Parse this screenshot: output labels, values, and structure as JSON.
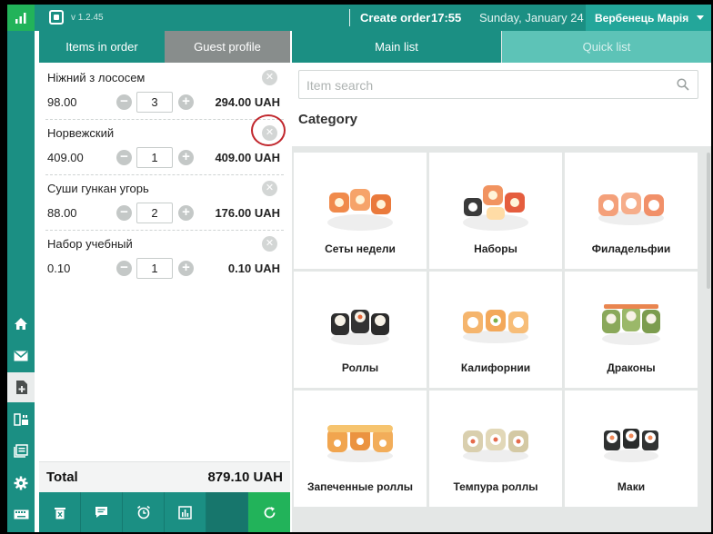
{
  "topbar": {
    "version": "v 1.2.45",
    "create_order": "Create order",
    "time": "17:55",
    "date": "Sunday, January 24",
    "user": "Вербенець Марія"
  },
  "order_tabs": [
    "Items in order",
    "Guest profile"
  ],
  "order_items": [
    {
      "name": "Ніжний з лососем",
      "price": "98.00",
      "qty": "3",
      "sum": "294.00 UAH"
    },
    {
      "name": "Норвежский",
      "price": "409.00",
      "qty": "1",
      "sum": "409.00 UAH"
    },
    {
      "name": "Суши гункан угорь",
      "price": "88.00",
      "qty": "2",
      "sum": "176.00 UAH"
    },
    {
      "name": "Набор учебный",
      "price": "0.10",
      "qty": "1",
      "sum": "0.10 UAH"
    }
  ],
  "total": {
    "label": "Total",
    "value": "879.10 UAH"
  },
  "catalog_tabs": [
    "Main list",
    "Quick list"
  ],
  "search": {
    "placeholder": "Item search"
  },
  "category_title": "Category",
  "categories": [
    {
      "label": "Сеты недели",
      "icon": "sushi-set-icon"
    },
    {
      "label": "Наборы",
      "icon": "sushi-set-icon"
    },
    {
      "label": "Филадельфии",
      "icon": "roll-icon"
    },
    {
      "label": "Роллы",
      "icon": "roll-icon"
    },
    {
      "label": "Калифорнии",
      "icon": "roll-icon"
    },
    {
      "label": "Драконы",
      "icon": "roll-icon"
    },
    {
      "label": "Запеченные роллы",
      "icon": "roll-icon"
    },
    {
      "label": "Темпура роллы",
      "icon": "roll-icon"
    },
    {
      "label": "Маки",
      "icon": "maki-icon"
    }
  ],
  "colors": {
    "teal": "#1b8f83",
    "green": "#22b35a",
    "light_teal": "#5dc3b7"
  }
}
